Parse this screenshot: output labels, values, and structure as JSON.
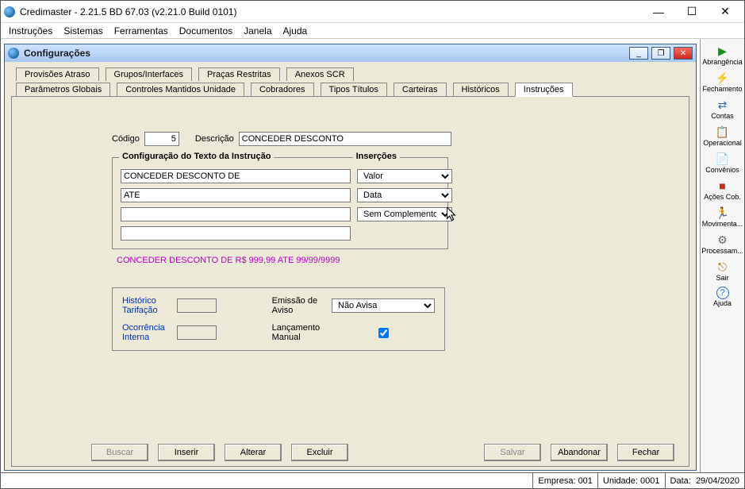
{
  "app": {
    "title": "Credimaster - 2.21.5 BD 67.03 (v2.21.0 Build 0101)"
  },
  "menus": [
    "Instruções",
    "Sistemas",
    "Ferramentas",
    "Documentos",
    "Janela",
    "Ajuda"
  ],
  "sidebar": [
    {
      "icon": "▶",
      "label": "Abrangência",
      "color": "#1a8a1a"
    },
    {
      "icon": "⚡",
      "label": "Fechamento",
      "color": "#e0a000"
    },
    {
      "icon": "⇄",
      "label": "Contas",
      "color": "#2a6ad0"
    },
    {
      "icon": "📋",
      "label": "Operacional",
      "color": "#2a6ad0"
    },
    {
      "icon": "📄",
      "label": "Convênios",
      "color": "#1a8a1a"
    },
    {
      "icon": "■",
      "label": "Ações Cob.",
      "color": "#cc2a1a"
    },
    {
      "icon": "🏃",
      "label": "Movimenta...",
      "color": "#000"
    },
    {
      "icon": "⚙",
      "label": "Processam...",
      "color": "#666"
    },
    {
      "icon": "⎋",
      "label": "Sair",
      "color": "#aa6a00"
    },
    {
      "icon": "?",
      "label": "Ajuda",
      "color": "#2a6ad0"
    }
  ],
  "child": {
    "title": "Configurações",
    "tabs_row1": [
      "Provisões Atraso",
      "Grupos/Interfaces",
      "Praças Restritas",
      "Anexos SCR"
    ],
    "tabs_row2": [
      "Parâmetros Globais",
      "Controles Mantidos Unidade",
      "Cobradores",
      "Tipos Títulos",
      "Carteiras",
      "Históricos",
      "Instruções"
    ],
    "active_tab": "Instruções",
    "form": {
      "codigo_label": "Código",
      "codigo_value": "5",
      "descricao_label": "Descrição",
      "descricao_value": "CONCEDER DESCONTO",
      "group_legend": "Configuração do Texto da Instrução",
      "insercoes_legend": "Inserções",
      "line1_text": "CONCEDER DESCONTO DE",
      "line1_insert": "Valor",
      "line2_text": "ATE",
      "line2_insert": "Data",
      "line3_text": "",
      "line3_insert": "Sem Complemento",
      "line4_text": "",
      "preview": "CONCEDER DESCONTO DE R$ 999,99 ATE 99/99/9999",
      "hist_tarif_label": "Histórico Tarifação",
      "hist_tarif_value": "",
      "ocorr_interna_label": "Ocorrência Interna",
      "ocorr_interna_value": "",
      "emissao_aviso_label": "Emissão de Aviso",
      "emissao_aviso_value": "Não Avisa",
      "lanc_manual_label": "Lançamento Manual",
      "lanc_manual_checked": true
    },
    "buttons": {
      "buscar": "Buscar",
      "inserir": "Inserir",
      "alterar": "Alterar",
      "excluir": "Excluir",
      "salvar": "Salvar",
      "abandonar": "Abandonar",
      "fechar": "Fechar"
    }
  },
  "status": {
    "empresa_label": "Empresa:",
    "empresa_value": "001",
    "unidade_label": "Unidade:",
    "unidade_value": "0001",
    "data_label": "Data:",
    "data_value": "29/04/2020"
  }
}
